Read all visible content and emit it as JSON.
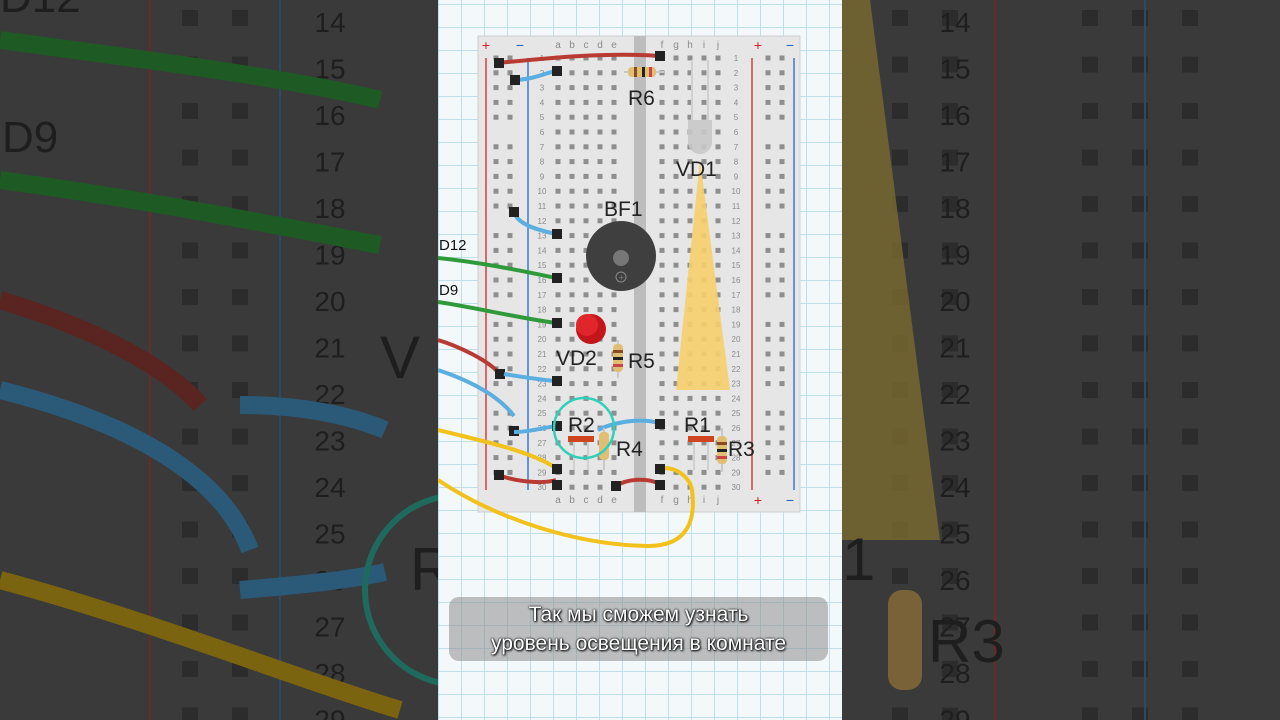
{
  "caption": {
    "line1": "Так мы сможем узнать",
    "line2": "уровень освещения в комнате"
  },
  "wire_labels": {
    "d12": "D12",
    "d9": "D9"
  },
  "components": {
    "r6": "R6",
    "vd1": "VD1",
    "bf1": "BF1",
    "vd2": "VD2",
    "r5": "R5",
    "r2": "R2",
    "r4": "R4",
    "r1": "R1",
    "r3": "R3"
  },
  "breadboard": {
    "columns_left": [
      "a",
      "b",
      "c",
      "d",
      "e"
    ],
    "columns_right": [
      "f",
      "g",
      "h",
      "i",
      "j"
    ],
    "plus": "+",
    "minus": "−",
    "rows": 30
  },
  "background": {
    "labels": {
      "d12": "D12",
      "d9": "D9",
      "vd": "V",
      "r": "R",
      "r3": "R3",
      "one": "1"
    },
    "row_numbers": [
      "14",
      "15",
      "16",
      "17",
      "18",
      "19",
      "20",
      "21",
      "22",
      "23",
      "24",
      "25",
      "26",
      "27",
      "28",
      "29"
    ]
  },
  "colors": {
    "wire_red": "#b83a32",
    "wire_blue": "#5aaee0",
    "wire_green": "#2f9a3a",
    "wire_yellow": "#f2c21a",
    "led_red": "#d0161a",
    "highlight": "#2fd0b8",
    "light_beam": "#f6cf6a"
  }
}
